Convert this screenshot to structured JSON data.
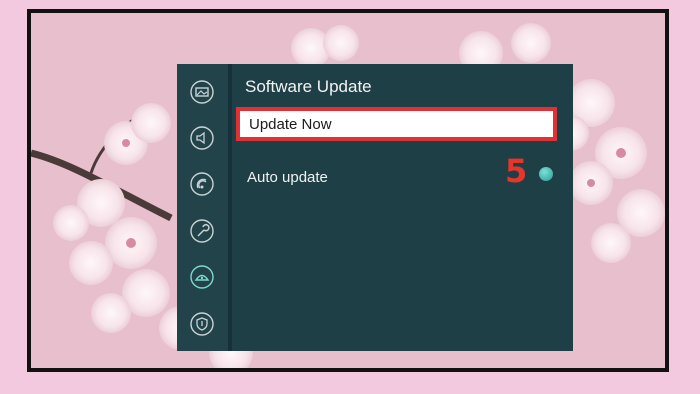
{
  "menu": {
    "title": "Software Update",
    "options": [
      {
        "label": "Update Now",
        "selected": true
      },
      {
        "label": "Auto update",
        "toggle": "on"
      }
    ]
  },
  "annotation": {
    "step": "5",
    "color": "#e8352a"
  },
  "sidebar": {
    "icons": [
      "picture-icon",
      "sound-icon",
      "connection-icon",
      "tools-icon",
      "support-icon",
      "shield-icon"
    ],
    "active": "support-icon"
  },
  "colors": {
    "menu_bg": "#1f3f46",
    "highlight_border": "#e03236",
    "toggle": "#2a9a93",
    "outer_bg": "#f3c9df"
  }
}
